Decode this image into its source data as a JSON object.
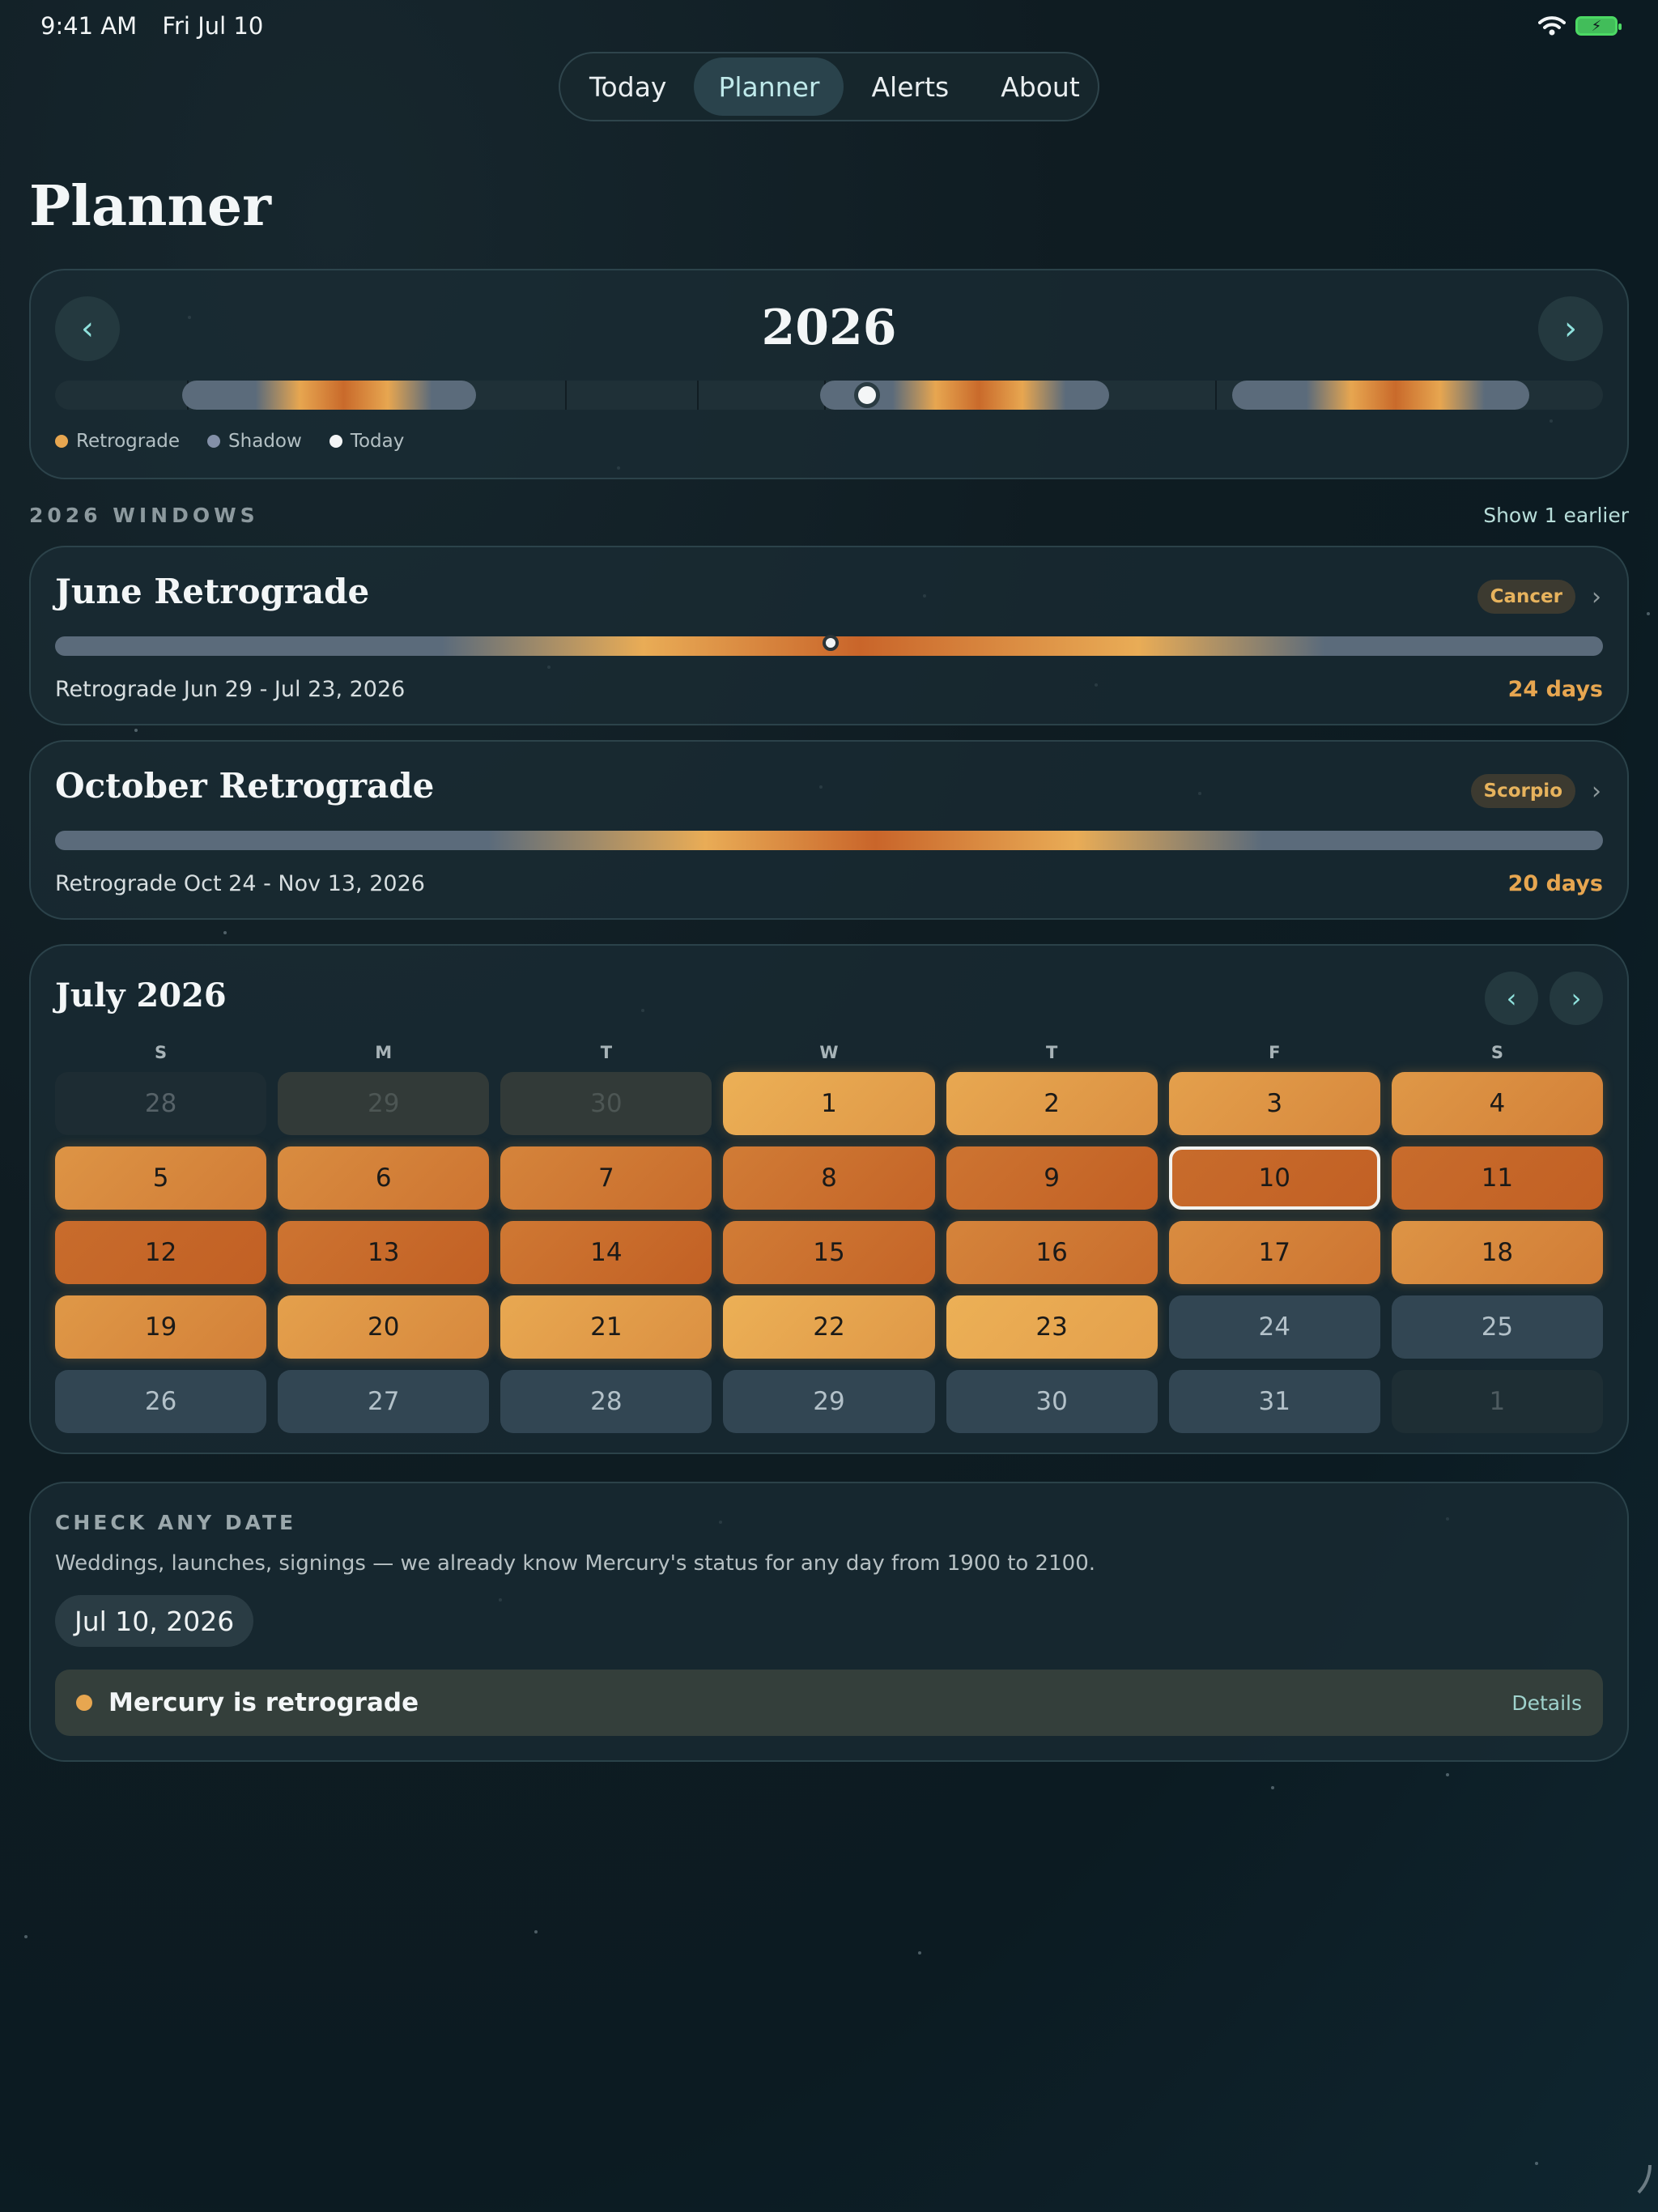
{
  "status_bar": {
    "time": "9:41 AM",
    "date": "Fri Jul 10"
  },
  "nav": {
    "tabs": [
      "Today",
      "Planner",
      "Alerts",
      "About"
    ],
    "active": "Planner"
  },
  "page": {
    "title": "Planner"
  },
  "year_card": {
    "year": "2026",
    "legend": [
      "Retrograde",
      "Shadow",
      "Today"
    ],
    "colors": {
      "retrograde": "#e7a650",
      "shadow": "#8390a8",
      "today": "#f4f6f7"
    },
    "retrograde_windows": [
      {
        "start_day_of_year": 30,
        "end_day_of_year": 99
      },
      {
        "start_day_of_year": 180,
        "end_day_of_year": 248
      },
      {
        "start_day_of_year": 277,
        "end_day_of_year": 347
      }
    ],
    "today_day_of_year": 191
  },
  "windows_section": {
    "title": "2026 WINDOWS",
    "link": "Show 1 earlier"
  },
  "windows": [
    {
      "title": "June Retrograde",
      "sign": "Cancer",
      "range": "Retrograde Jun 29 - Jul 23, 2026",
      "days": "24 days",
      "today_fraction": 0.5
    },
    {
      "title": "October Retrograde",
      "sign": "Scorpio",
      "range": "Retrograde Oct 24 - Nov 13, 2026",
      "days": "20 days"
    }
  ],
  "calendar": {
    "title": "July 2026",
    "weekdays": [
      "S",
      "M",
      "T",
      "W",
      "T",
      "F",
      "S"
    ],
    "days": [
      {
        "n": "28",
        "style": "muted"
      },
      {
        "n": "29",
        "style": "dim"
      },
      {
        "n": "30",
        "style": "dim"
      },
      {
        "n": "1",
        "intensity": 0.15
      },
      {
        "n": "2",
        "intensity": 0.25
      },
      {
        "n": "3",
        "intensity": 0.35
      },
      {
        "n": "4",
        "intensity": 0.45
      },
      {
        "n": "5",
        "intensity": 0.5
      },
      {
        "n": "6",
        "intensity": 0.6
      },
      {
        "n": "7",
        "intensity": 0.7
      },
      {
        "n": "8",
        "intensity": 0.8
      },
      {
        "n": "9",
        "intensity": 0.9
      },
      {
        "n": "10",
        "intensity": 1.0,
        "selected": true
      },
      {
        "n": "11",
        "intensity": 1.0
      },
      {
        "n": "12",
        "intensity": 1.0
      },
      {
        "n": "13",
        "intensity": 0.9
      },
      {
        "n": "14",
        "intensity": 0.85
      },
      {
        "n": "15",
        "intensity": 0.8
      },
      {
        "n": "16",
        "intensity": 0.7
      },
      {
        "n": "17",
        "intensity": 0.6
      },
      {
        "n": "18",
        "intensity": 0.5
      },
      {
        "n": "19",
        "intensity": 0.45
      },
      {
        "n": "20",
        "intensity": 0.35
      },
      {
        "n": "21",
        "intensity": 0.25
      },
      {
        "n": "22",
        "intensity": 0.15
      },
      {
        "n": "23",
        "intensity": 0.05
      },
      {
        "n": "24",
        "style": "plain"
      },
      {
        "n": "25",
        "style": "plain"
      },
      {
        "n": "26",
        "style": "plain"
      },
      {
        "n": "27",
        "style": "plain"
      },
      {
        "n": "28",
        "style": "plain"
      },
      {
        "n": "29",
        "style": "plain"
      },
      {
        "n": "30",
        "style": "plain"
      },
      {
        "n": "31",
        "style": "plain"
      },
      {
        "n": "1",
        "style": "lite"
      }
    ]
  },
  "check": {
    "title": "CHECK ANY DATE",
    "description": "Weddings, launches, signings — we already know Mercury's status for any day from 1900 to 2100.",
    "date": "Jul 10, 2026",
    "status": "Mercury is retrograde",
    "details": "Details"
  }
}
